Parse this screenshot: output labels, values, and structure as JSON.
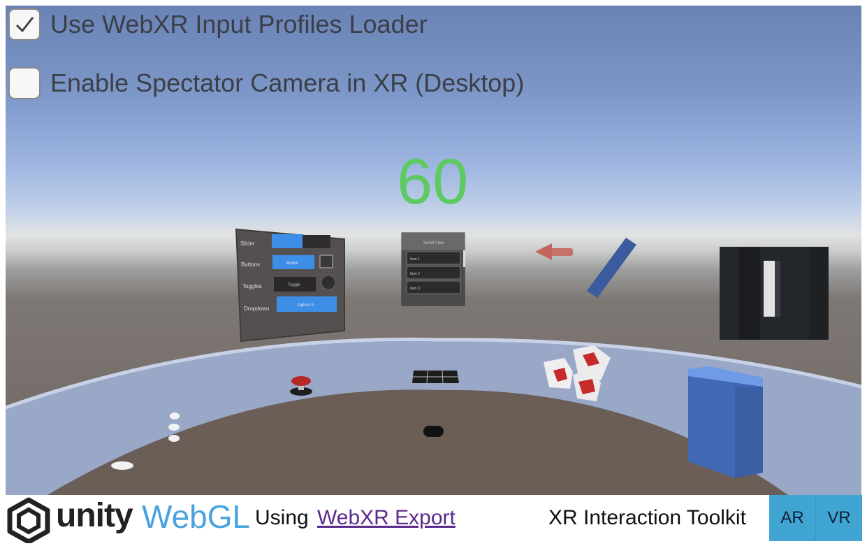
{
  "options": {
    "input_profiles": {
      "label": "Use WebXR Input Profiles Loader",
      "checked": true
    },
    "spectator": {
      "label": "Enable Spectator Camera in XR (Desktop)",
      "checked": false
    }
  },
  "scene": {
    "fps": "60",
    "ui_panel": {
      "slider_label": "Slider",
      "buttons_label": "Buttons",
      "toggles_label": "Toggles",
      "dropdown_label": "Dropdown",
      "button_text": "Button",
      "toggle_text": "Toggle",
      "dropdown_text": "Option A"
    },
    "scroll_panel": {
      "title": "Scroll View",
      "items": [
        "Item 1",
        "Item 2",
        "Item 3"
      ]
    }
  },
  "footer": {
    "unity_word": "unity",
    "webgl_word": "WebGL",
    "using_text": "Using",
    "link_text": "WebXR Export",
    "toolkit_text": "XR Interaction Toolkit",
    "ar_label": "AR",
    "vr_label": "VR"
  },
  "colors": {
    "fps": "#5dca62",
    "accent_button": "#41a5d4",
    "webgl_blue": "#4aa3df"
  }
}
